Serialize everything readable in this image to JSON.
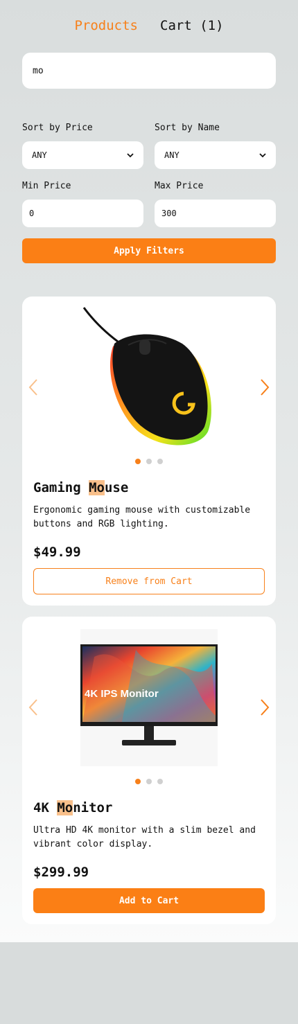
{
  "nav": {
    "products_label": "Products",
    "cart_label": "Cart (1)"
  },
  "search": {
    "value": "mo"
  },
  "filters": {
    "sort_price_label": "Sort by Price",
    "sort_price_value": "ANY",
    "sort_name_label": "Sort by Name",
    "sort_name_value": "ANY",
    "min_price_label": "Min Price",
    "min_price_value": "0",
    "max_price_label": "Max Price",
    "max_price_value": "300",
    "apply_label": "Apply Filters"
  },
  "products": [
    {
      "title_match": "Mo",
      "title_before": "Gaming ",
      "title_after": "use",
      "description": "Ergonomic gaming mouse with customizable buttons and RGB lighting.",
      "price": "$49.99",
      "action_label": "Remove from Cart",
      "in_cart": true,
      "image_count": 3,
      "active_image": 1
    },
    {
      "title_before": "4K ",
      "title_match": "Mo",
      "title_after": "nitor",
      "description": "Ultra HD 4K monitor with a slim bezel and vibrant color display.",
      "price": "$299.99",
      "action_label": "Add to Cart",
      "in_cart": false,
      "image_count": 3,
      "active_image": 1,
      "image_caption": "4K IPS Monitor"
    }
  ],
  "colors": {
    "accent": "#f7801a",
    "highlight": "#f9c08b"
  }
}
